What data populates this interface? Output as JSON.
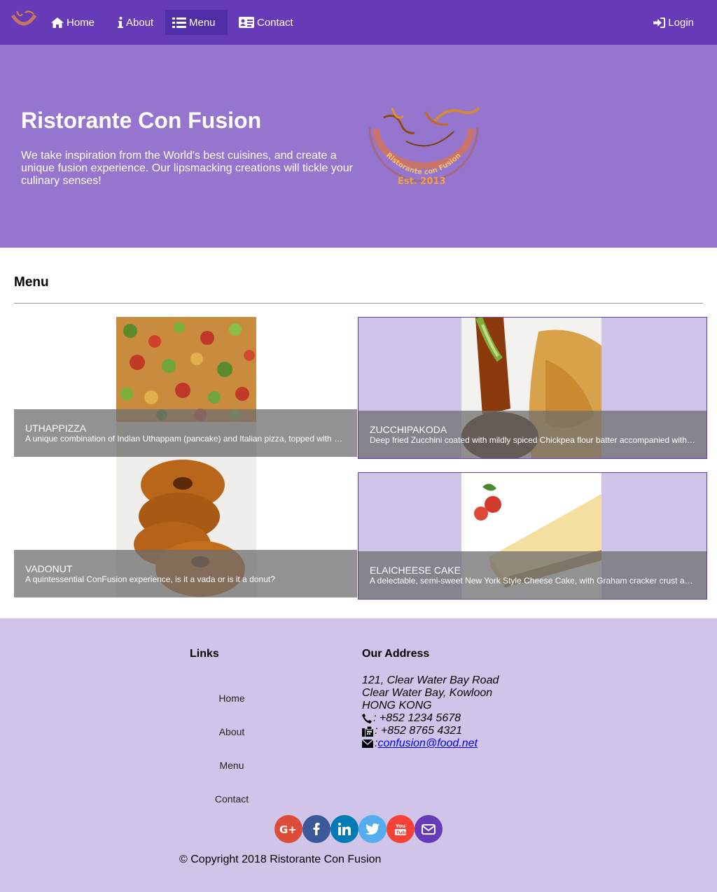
{
  "nav": {
    "items": [
      {
        "label": "Home",
        "icon": "home-icon"
      },
      {
        "label": "About",
        "icon": "info-icon"
      },
      {
        "label": "Menu",
        "icon": "list-icon"
      },
      {
        "label": "Contact",
        "icon": "address-card-icon"
      }
    ],
    "active": "Menu",
    "login_label": "Login"
  },
  "jumbotron": {
    "title": "Ristorante Con Fusion",
    "text": "We take inspiration from the World's best cuisines, and create a unique fusion experience. Our lipsmacking creations will tickle your culinary senses!",
    "logo_text": "Ristorante con Fusion",
    "logo_est": "Est. 2013"
  },
  "menu": {
    "title": "Menu",
    "dishes": [
      {
        "name": "UTHAPPIZZA",
        "description": "A unique combination of Indian Uthappam (pancake) and Italian pizza, topped with Cerignola olives, ripe vine cherry tomatoes, Vidalia onion, Guntur chillies and Buffalo Paneer."
      },
      {
        "name": "ZUCCHIPAKODA",
        "description": "Deep fried Zucchini coated with mildly spiced Chickpea flour batter accompanied with a sweet-tangy tamarind sauce"
      },
      {
        "name": "VADONUT",
        "description": "A quintessential ConFusion experience, is it a vada or is it a donut?"
      },
      {
        "name": "ELAICHEESE CAKE",
        "description": "A delectable, semi-sweet New York Style Cheese Cake, with Graham cracker crust and spiced with Indian cardamoms"
      }
    ]
  },
  "footer": {
    "links_title": "Links",
    "links": [
      "Home",
      "About",
      "Menu",
      "Contact"
    ],
    "address_title": "Our Address",
    "address_lines": [
      "121, Clear Water Bay Road",
      "Clear Water Bay, Kowloon",
      "HONG KONG"
    ],
    "phone": ": +852 1234 5678",
    "fax": ": +852 8765 4321",
    "email_prefix": ": ",
    "email": "confusion@food.net",
    "social": [
      {
        "name": "google-plus",
        "color": "#dd4b39"
      },
      {
        "name": "facebook",
        "color": "#3b5998"
      },
      {
        "name": "linkedin",
        "color": "#007bb6"
      },
      {
        "name": "twitter",
        "color": "#55acee"
      },
      {
        "name": "youtube",
        "color": "#f44336"
      },
      {
        "name": "mail",
        "color": "#673ab7"
      }
    ],
    "copyright": "© Copyright 2018 Ristorante Con Fusion"
  },
  "colors": {
    "primary": "#673ab7",
    "primary_dark": "#512da8",
    "primary_light": "#9575cd",
    "footer_bg": "#d1c4e9"
  }
}
